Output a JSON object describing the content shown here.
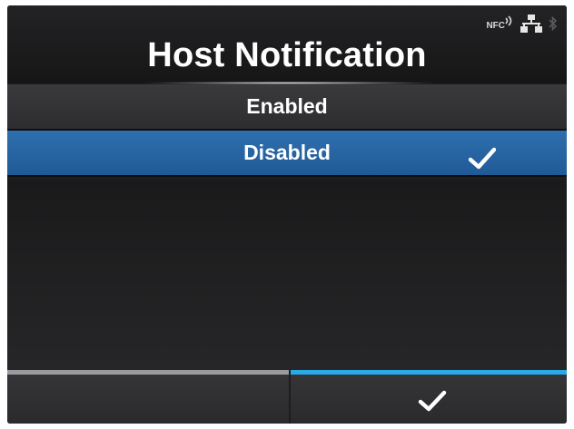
{
  "screen": {
    "title": "Host Notification",
    "status_icons": {
      "nfc_label": "NFC",
      "nfc": "nfc-icon",
      "network": "network-icon",
      "bluetooth": "bluetooth-icon"
    }
  },
  "options": [
    {
      "label": "Enabled",
      "selected": false
    },
    {
      "label": "Disabled",
      "selected": true
    }
  ],
  "footer": {
    "confirm_icon": "check-icon"
  },
  "colors": {
    "background": "#1d1d1f",
    "selected_row": "#1f5a96",
    "confirm_accent": "#29a9e6",
    "inactive_accent": "#9b9b9e"
  }
}
